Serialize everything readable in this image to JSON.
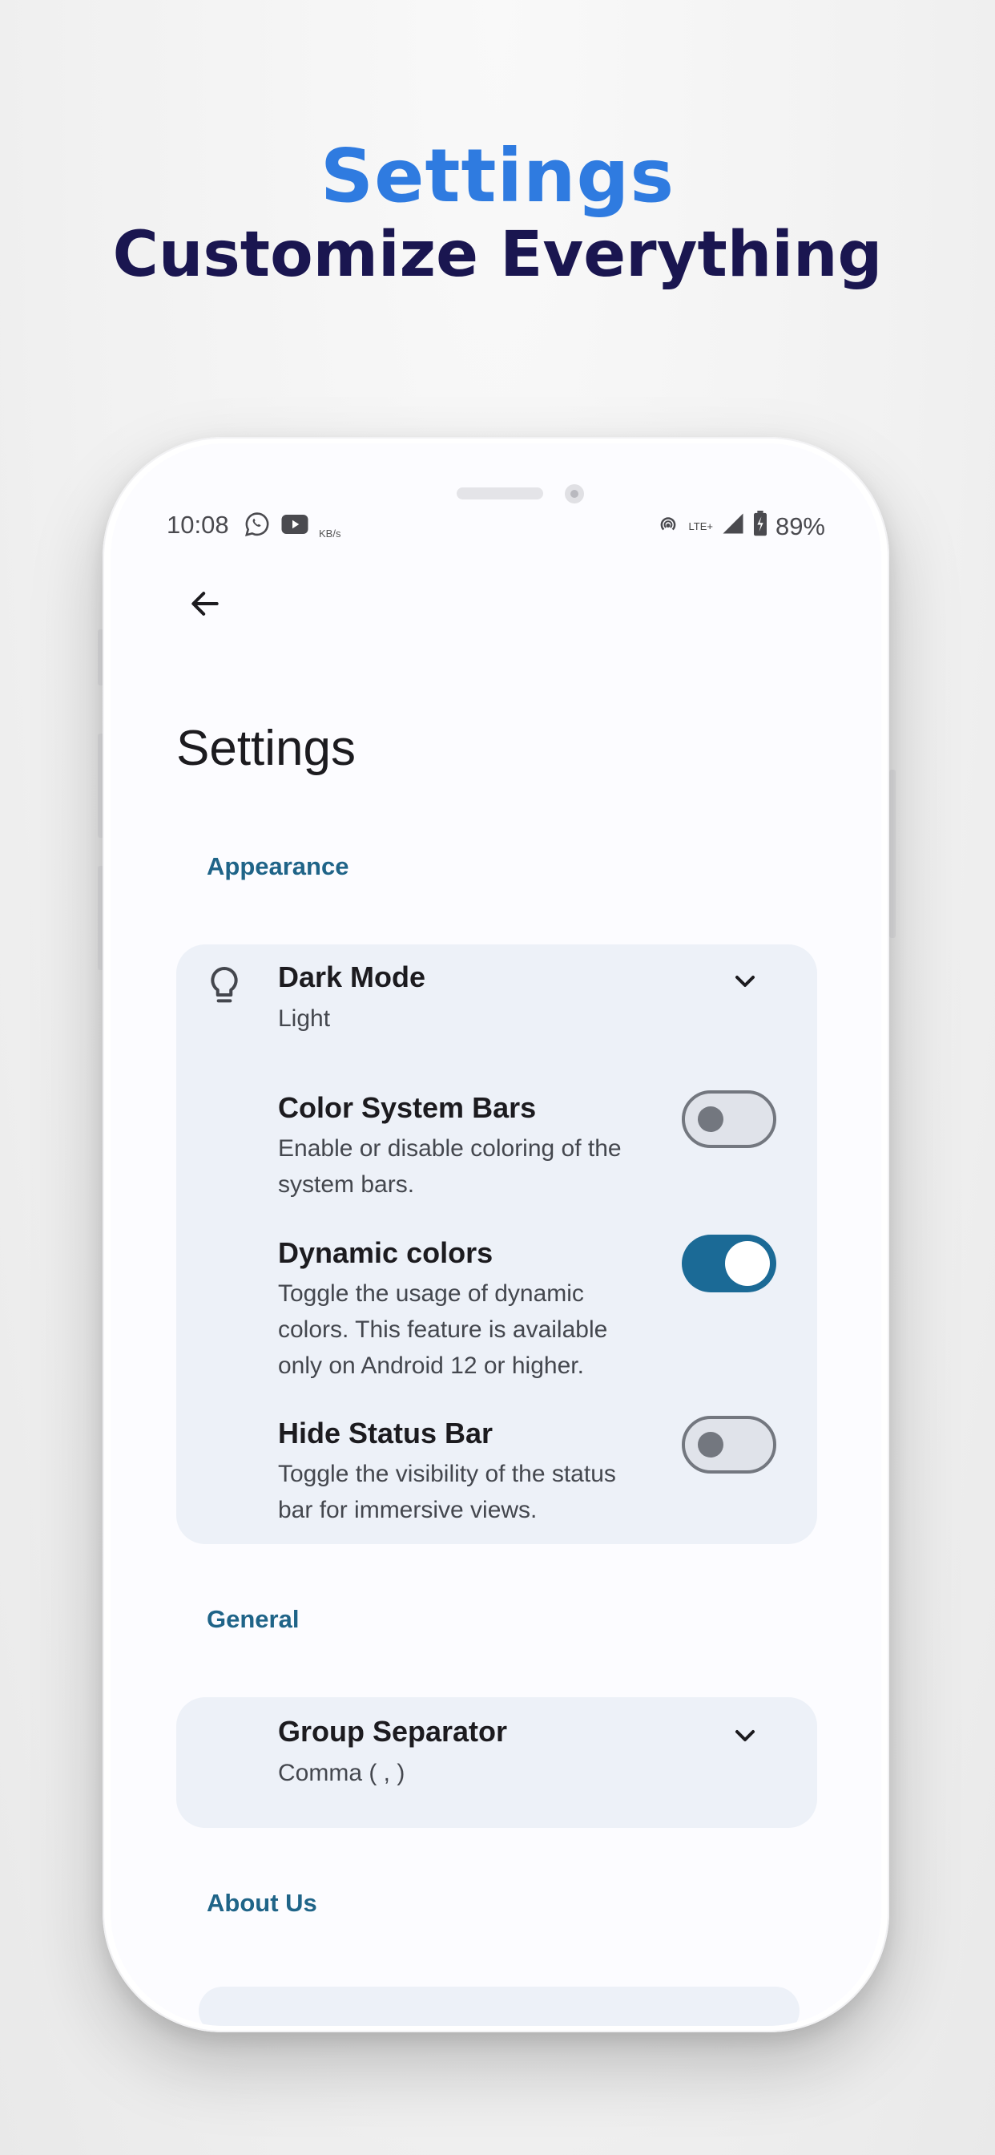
{
  "promo": {
    "title": "Settings",
    "subtitle": "Customize Everything"
  },
  "status_bar": {
    "time": "10:08",
    "battery": "89%",
    "network": "LTE+",
    "speed_unit": "KB/s",
    "left_icons": [
      "whatsapp-icon",
      "youtube-icon"
    ],
    "right_icons": [
      "hotspot-icon",
      "signal-icon",
      "battery-icon"
    ]
  },
  "header": {
    "back_icon": "arrow-left-icon",
    "title": "Settings"
  },
  "sections": {
    "appearance": {
      "label": "Appearance",
      "dark_mode": {
        "icon": "lightbulb-icon",
        "title": "Dark Mode",
        "value": "Light"
      },
      "color_system_bars": {
        "title": "Color System Bars",
        "description": "Enable or disable coloring of the system bars.",
        "enabled": false
      },
      "dynamic_colors": {
        "title": "Dynamic colors",
        "description": "Toggle the usage of dynamic colors. This feature is available only on Android 12 or higher.",
        "enabled": true
      },
      "hide_status_bar": {
        "title": "Hide Status Bar",
        "description": "Toggle the visibility of the status bar for immersive views.",
        "enabled": false
      }
    },
    "general": {
      "label": "General",
      "group_separator": {
        "title": "Group Separator",
        "value": "Comma ( , )"
      }
    },
    "about": {
      "label": "About Us"
    }
  },
  "colors": {
    "accent": "#1b6a96",
    "section_label": "#1f6488",
    "card_bg": "#edf1f8",
    "promo_title": "#2f7be0",
    "promo_subtitle": "#1a1650"
  }
}
